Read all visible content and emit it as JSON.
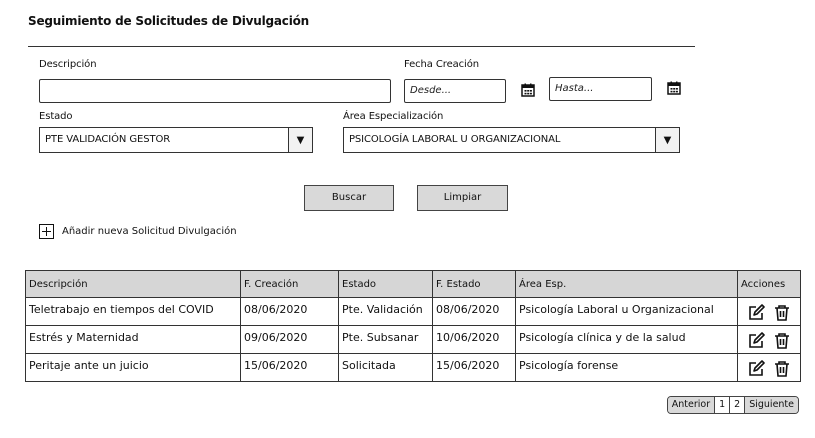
{
  "page": {
    "title": "Seguimiento de Solicitudes de Divulgación"
  },
  "filters": {
    "descripcion": {
      "label": "Descripción",
      "value": ""
    },
    "fecha_creacion": {
      "label": "Fecha Creación",
      "desde_placeholder": "Desde...",
      "hasta_placeholder": "Hasta..."
    },
    "estado": {
      "label": "Estado",
      "selected": "PTE VALIDACIÓN GESTOR"
    },
    "area": {
      "label": "Área Especialización",
      "selected": "PSICOLOGÍA LABORAL U ORGANIZACIONAL"
    },
    "buscar_label": "Buscar",
    "limpiar_label": "Limpiar",
    "add_label": "Añadir nueva Solicitud Divulgación"
  },
  "table": {
    "headers": [
      "Descripción",
      "F. Creación",
      "Estado",
      "F. Estado",
      "Área Esp.",
      "Acciones"
    ],
    "rows": [
      [
        "Teletrabajo en tiempos del COVID",
        "08/06/2020",
        "Pte. Validación",
        "08/06/2020",
        "Psicología Laboral u Organizacional"
      ],
      [
        "Estrés y Maternidad",
        "09/06/2020",
        "Pte. Subsanar",
        "10/06/2020",
        "Psicología clínica y de la salud"
      ],
      [
        "Peritaje ante un juicio",
        "15/06/2020",
        "Solicitada",
        "15/06/2020",
        "Psicología forense"
      ]
    ],
    "row_icons": [
      "edit-icon",
      "trash-icon"
    ]
  },
  "pagination": {
    "prev": "Anterior",
    "pages": [
      "1",
      "2"
    ],
    "next": "Siguiente"
  },
  "icons": {
    "calendar": "calendar-icon",
    "dropdown": "triangle-down-icon",
    "add": "plus-square-icon"
  }
}
